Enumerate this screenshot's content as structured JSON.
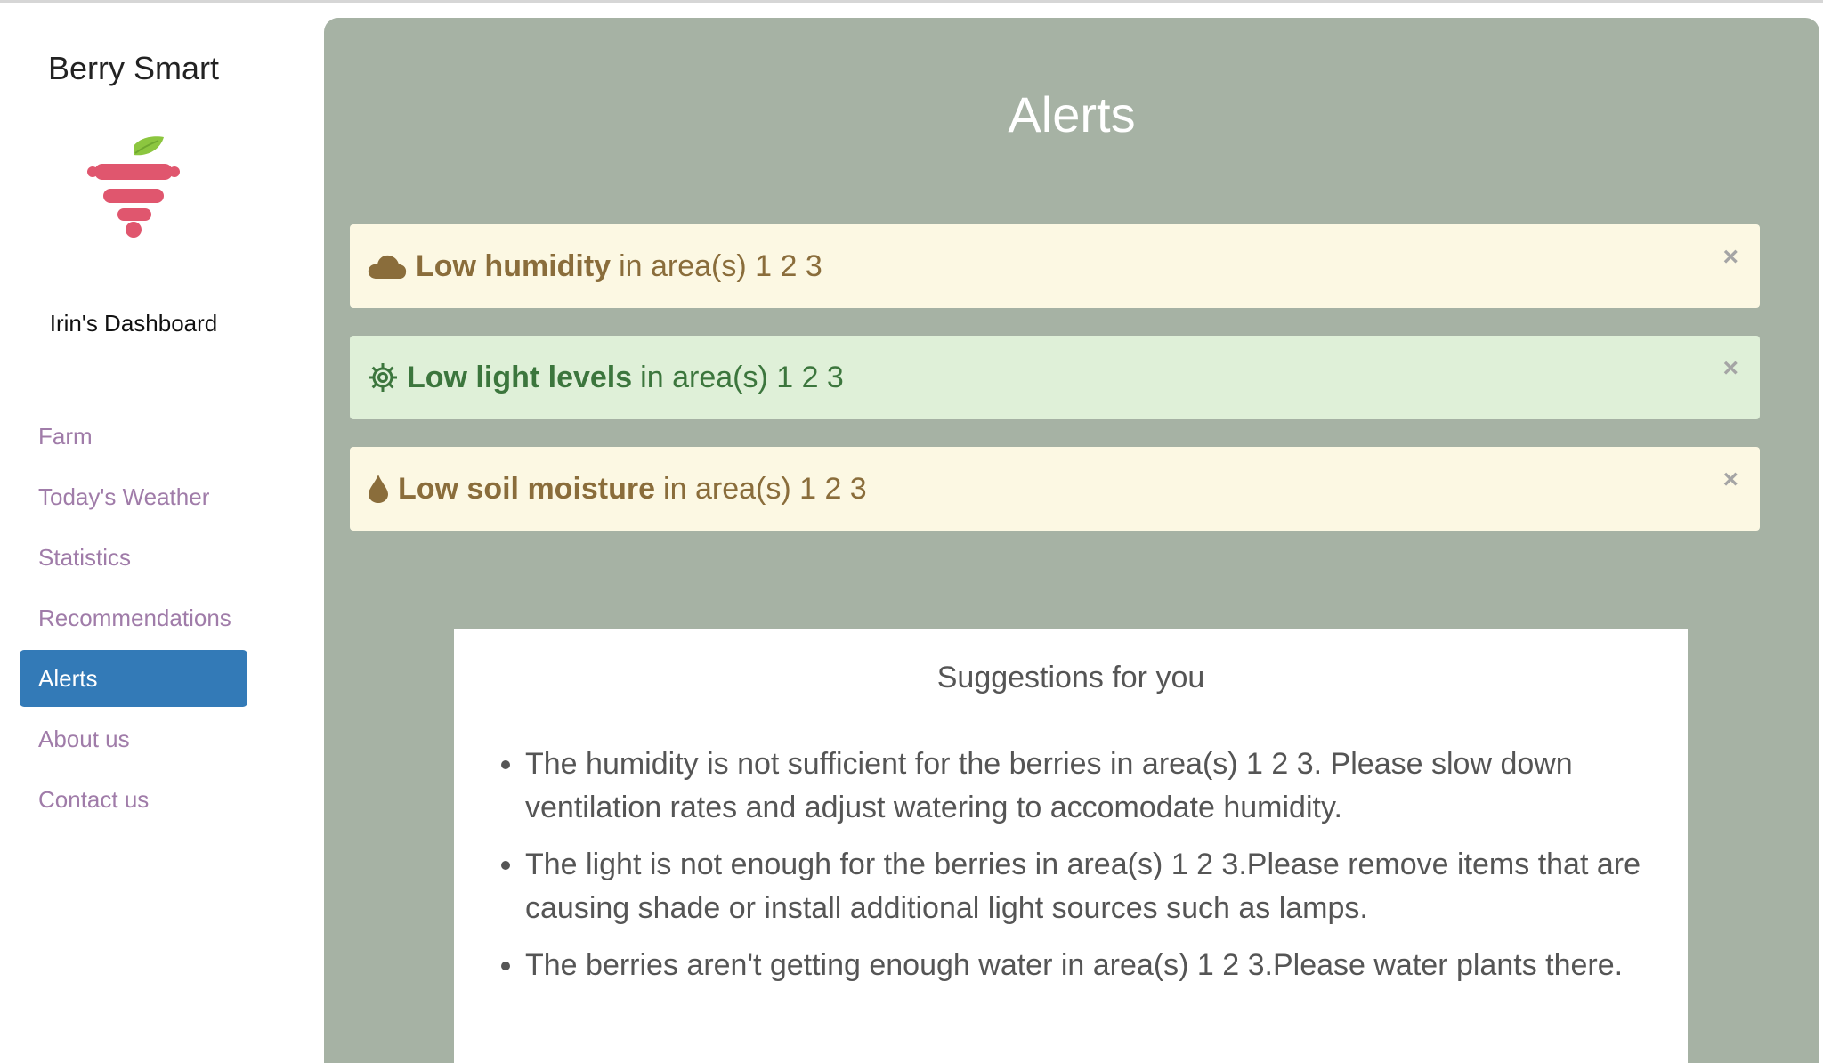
{
  "sidebar": {
    "brand": "Berry Smart",
    "dashboard_title": "Irin's Dashboard",
    "nav": [
      {
        "label": "Farm"
      },
      {
        "label": "Today's Weather"
      },
      {
        "label": "Statistics"
      },
      {
        "label": "Recommendations"
      },
      {
        "label": "Alerts",
        "active": true
      },
      {
        "label": "About us"
      },
      {
        "label": "Contact us"
      }
    ]
  },
  "main": {
    "title": "Alerts",
    "alerts": [
      {
        "icon": "cloud-icon",
        "strong": "Low humidity",
        "text": "in area(s) 1 2 3",
        "close": "×",
        "style": "warning"
      },
      {
        "icon": "gear-icon",
        "strong": "Low light levels",
        "text": "in area(s) 1 2 3",
        "close": "×",
        "style": "success"
      },
      {
        "icon": "water-drop-icon",
        "strong": "Low soil moisture",
        "text": "in area(s) 1 2 3",
        "close": "×",
        "style": "warning"
      }
    ],
    "suggestions": {
      "title": "Suggestions for you",
      "items": [
        "The humidity is not sufficient for the berries in area(s) 1 2 3. Please slow down ventilation rates and adjust watering to accomodate humidity.",
        "The light is not enough for the berries in area(s) 1 2 3.Please remove items that are causing shade or install additional light sources such as lamps.",
        "The berries aren't getting enough water in area(s) 1 2 3.Please water plants there."
      ]
    }
  },
  "colors": {
    "panel_bg": "#a6b2a4",
    "nav_active": "#337ab7",
    "nav_link": "#a07ca9",
    "alert_warning_bg": "#fcf8e3",
    "alert_warning_text": "#8a6d3b",
    "alert_success_bg": "#dff0d8",
    "alert_success_text": "#3c763d",
    "logo_berry": "#e0566e",
    "logo_leaf": "#8cc63f"
  }
}
